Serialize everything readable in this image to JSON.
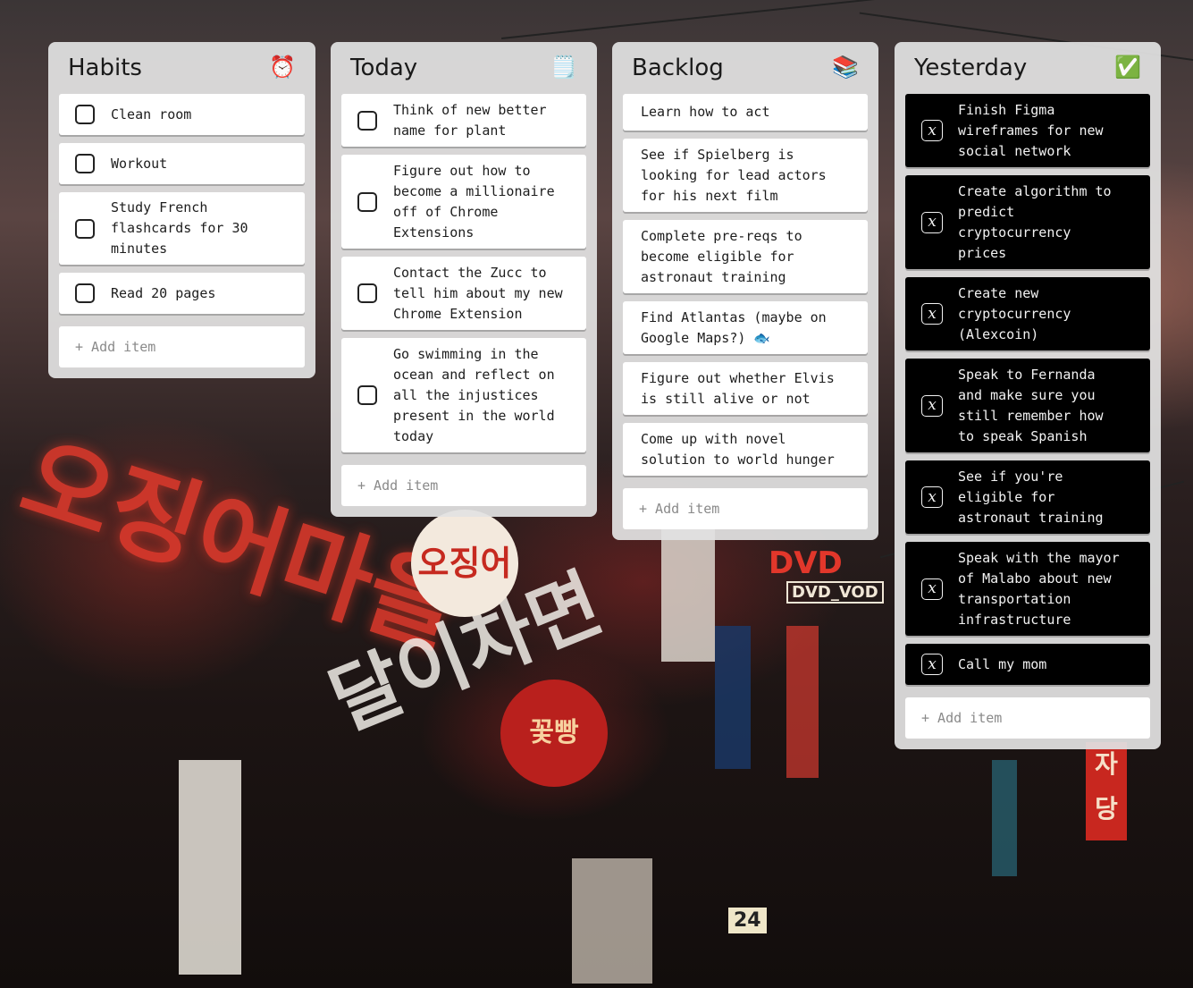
{
  "columns": {
    "habits": {
      "title": "Habits",
      "icon": "⏰",
      "icon_name": "alarm-clock-icon",
      "items": [
        "Clean room",
        "Workout",
        "Study French flashcards for 30 minutes",
        "Read 20 pages"
      ],
      "add_label": "+ Add item"
    },
    "today": {
      "title": "Today",
      "icon": "🗒️",
      "icon_name": "notepad-icon",
      "items": [
        "Think of new better name for plant",
        "Figure out how to become a millionaire off of Chrome Extensions",
        "Contact the Zucc to tell him about my new Chrome Extension",
        "Go swimming in the ocean and reflect on all the injustices present in the world today"
      ],
      "add_label": "+ Add item"
    },
    "backlog": {
      "title": "Backlog",
      "icon": "📚",
      "icon_name": "books-icon",
      "items": [
        "Learn how to act",
        "See if Spielberg is looking for lead actors for his next film",
        "Complete pre-reqs to become eligible for astronaut training",
        "Find Atlantas (maybe on Google Maps?) 🐟",
        "Figure out whether Elvis is still alive or not",
        "Come up with novel solution to world hunger"
      ],
      "add_label": "+ Add item"
    },
    "yesterday": {
      "title": "Yesterday",
      "icon": "✅",
      "icon_name": "check-mark-icon",
      "items": [
        "Finish Figma wireframes for new social network",
        "Create algorithm to predict cryptocurrency prices",
        "Create new cryptocurrency (Alexcoin)",
        "Speak to Fernanda and make sure you still remember how to speak Spanish",
        "See if you're eligible for astronaut training",
        "Speak with the mayor of Malabo about new transportation infrastructure",
        "Call my mom"
      ],
      "add_label": "+ Add item"
    }
  },
  "colors": {
    "column_bg": "#e2e2e2",
    "card_bg": "#ffffff",
    "done_card_bg": "#000000",
    "text": "#1d1d1d",
    "placeholder": "#8a8a8a"
  }
}
